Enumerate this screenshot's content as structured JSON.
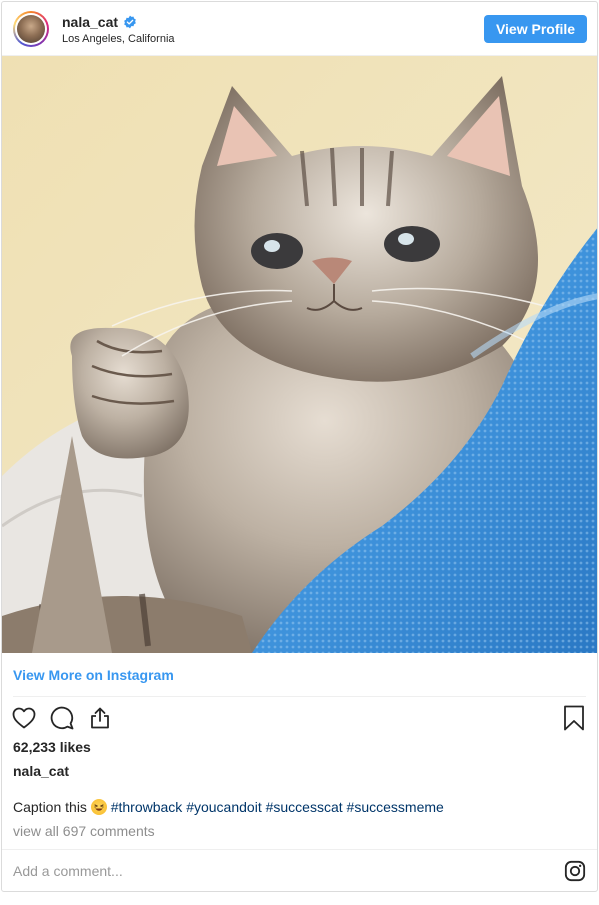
{
  "header": {
    "username": "nala_cat",
    "location": "Los Angeles, California",
    "view_profile_label": "View Profile",
    "verified_icon": "verified-badge-icon"
  },
  "photo": {
    "subject_icon": "cat-photo"
  },
  "view_more_label": "View More on Instagram",
  "actions": {
    "like_icon": "heart-icon",
    "comment_icon": "comment-icon",
    "share_icon": "share-icon",
    "save_icon": "bookmark-icon"
  },
  "likes_text": "62,233 likes",
  "caption": {
    "username": "nala_cat",
    "prefix": "Caption this",
    "emoji": "laughing-face-emoji",
    "tags": [
      "#throwback",
      "#youcandoit",
      "#successcat",
      "#successmeme"
    ]
  },
  "view_comments_label": "view all 697 comments",
  "comment_placeholder": "Add a comment...",
  "colors": {
    "accent": "#3897f0",
    "hashtag": "#003569",
    "muted": "#8e8e8e",
    "text": "#262626"
  }
}
